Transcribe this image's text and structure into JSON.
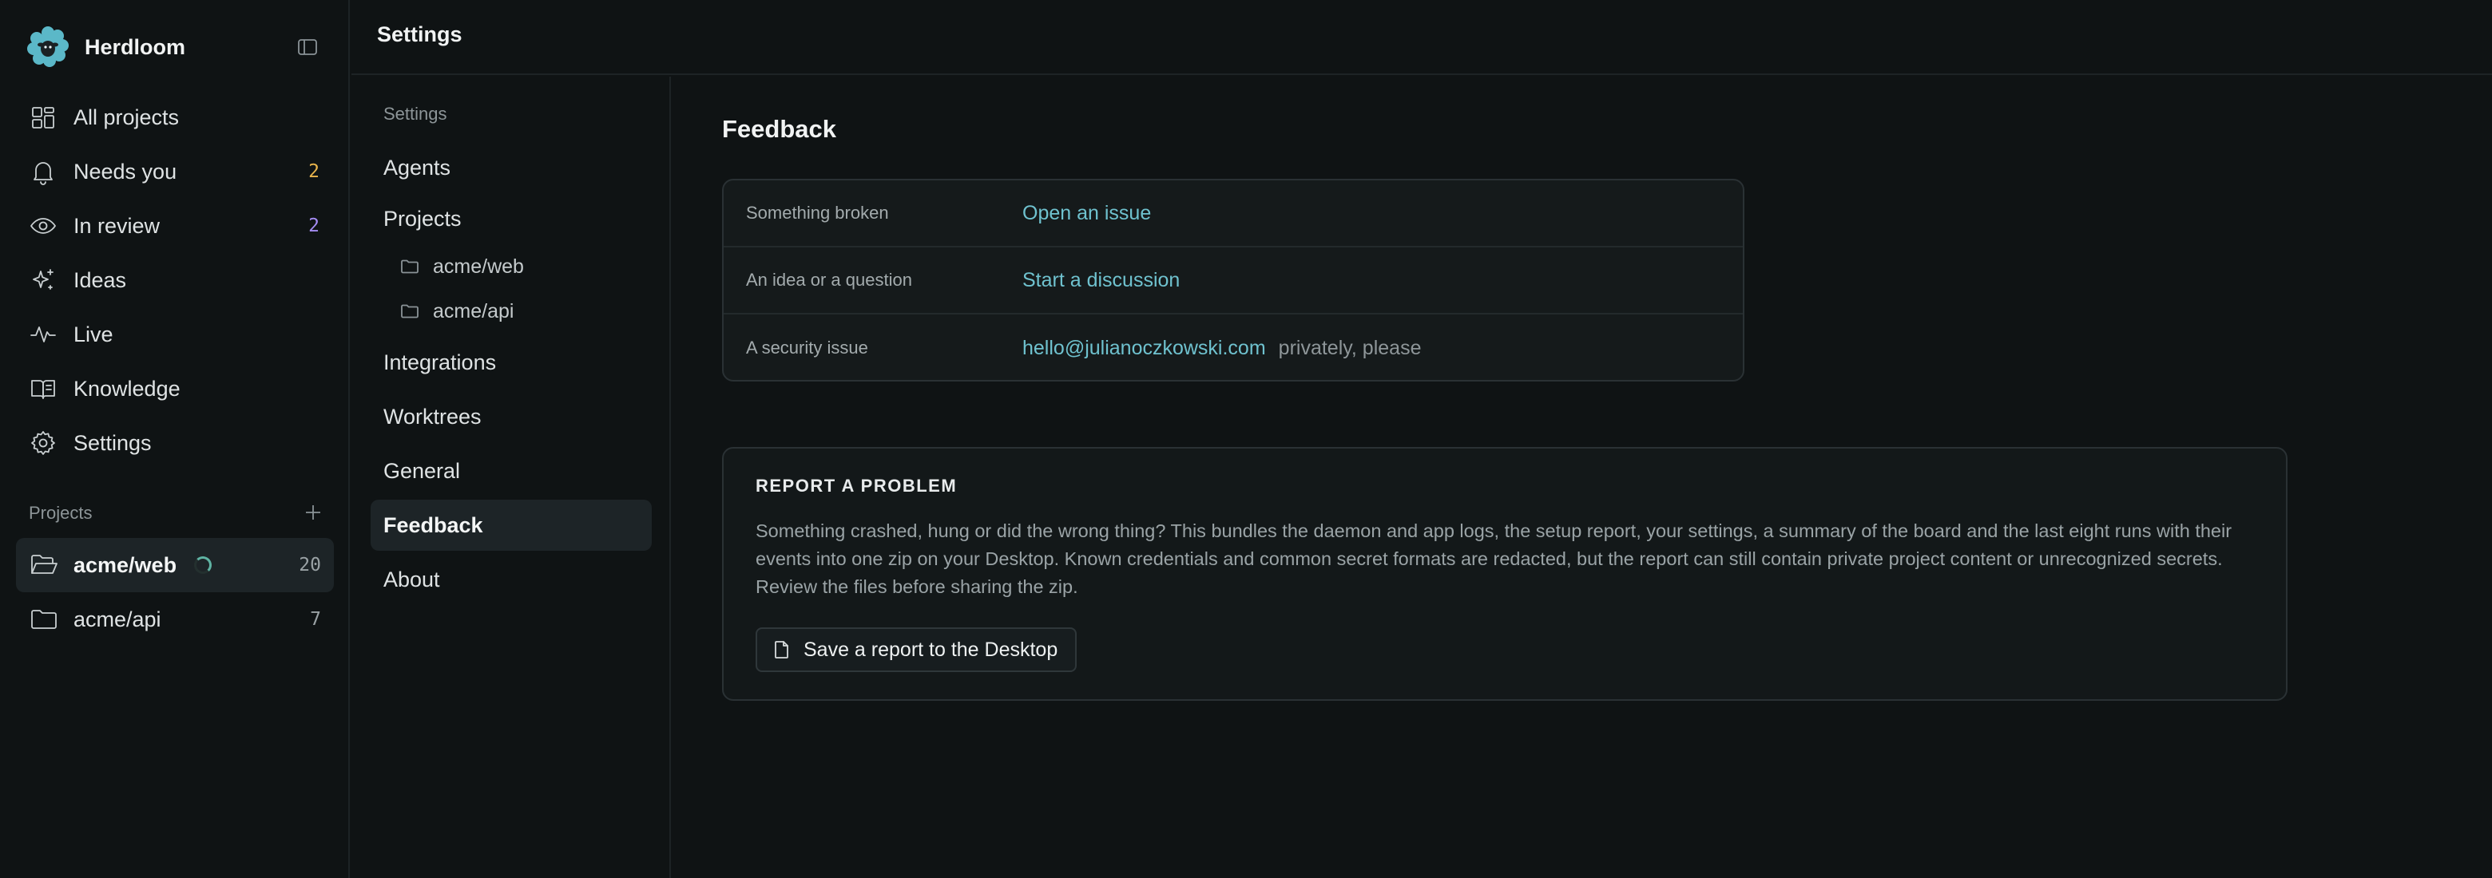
{
  "app": {
    "name": "Herdloom",
    "colors": {
      "background": "#0f1314",
      "accent_link": "#6fc2cf",
      "count_amber": "#e8b44c",
      "count_purple": "#a48cf2",
      "logo": "#5bb8c8"
    }
  },
  "sidebar": {
    "nav": [
      {
        "label": "All projects",
        "icon": "grid-icon",
        "count": ""
      },
      {
        "label": "Needs you",
        "icon": "bell-icon",
        "count": "2"
      },
      {
        "label": "In review",
        "icon": "eye-icon",
        "count": "2"
      },
      {
        "label": "Ideas",
        "icon": "sparkle-icon",
        "count": ""
      },
      {
        "label": "Live",
        "icon": "pulse-icon",
        "count": ""
      },
      {
        "label": "Knowledge",
        "icon": "book-icon",
        "count": ""
      },
      {
        "label": "Settings",
        "icon": "gear-icon",
        "count": ""
      }
    ],
    "projects_heading": "Projects",
    "projects": [
      {
        "label": "acme/web",
        "count": "20",
        "active": true,
        "loading": true
      },
      {
        "label": "acme/api",
        "count": "7",
        "active": false,
        "loading": false
      }
    ]
  },
  "header": {
    "title": "Settings"
  },
  "settings_nav": {
    "heading": "Settings",
    "items": {
      "agents": "Agents",
      "projects": "Projects",
      "project_web": "acme/web",
      "project_api": "acme/api",
      "integrations": "Integrations",
      "worktrees": "Worktrees",
      "general": "General",
      "feedback": "Feedback",
      "about": "About"
    },
    "active": "Feedback"
  },
  "main": {
    "title": "Feedback",
    "feedback_rows": [
      {
        "label": "Something broken",
        "link": "Open an issue",
        "note": ""
      },
      {
        "label": "An idea or a question",
        "link": "Start a discussion",
        "note": ""
      },
      {
        "label": "A security issue",
        "link": "hello@julianoczkowski.com",
        "note": "privately, please"
      }
    ],
    "report": {
      "title": "REPORT A PROBLEM",
      "description": "Something crashed, hung or did the wrong thing? This bundles the daemon and app logs, the setup report, your settings, a summary of the board and the last eight runs with their events into one zip on your Desktop. Known credentials and common secret formats are redacted, but the report can still contain private project content or unrecognized secrets. Review the files before sharing the zip.",
      "button_label": "Save a report to the Desktop",
      "button_icon": "file-icon"
    }
  }
}
